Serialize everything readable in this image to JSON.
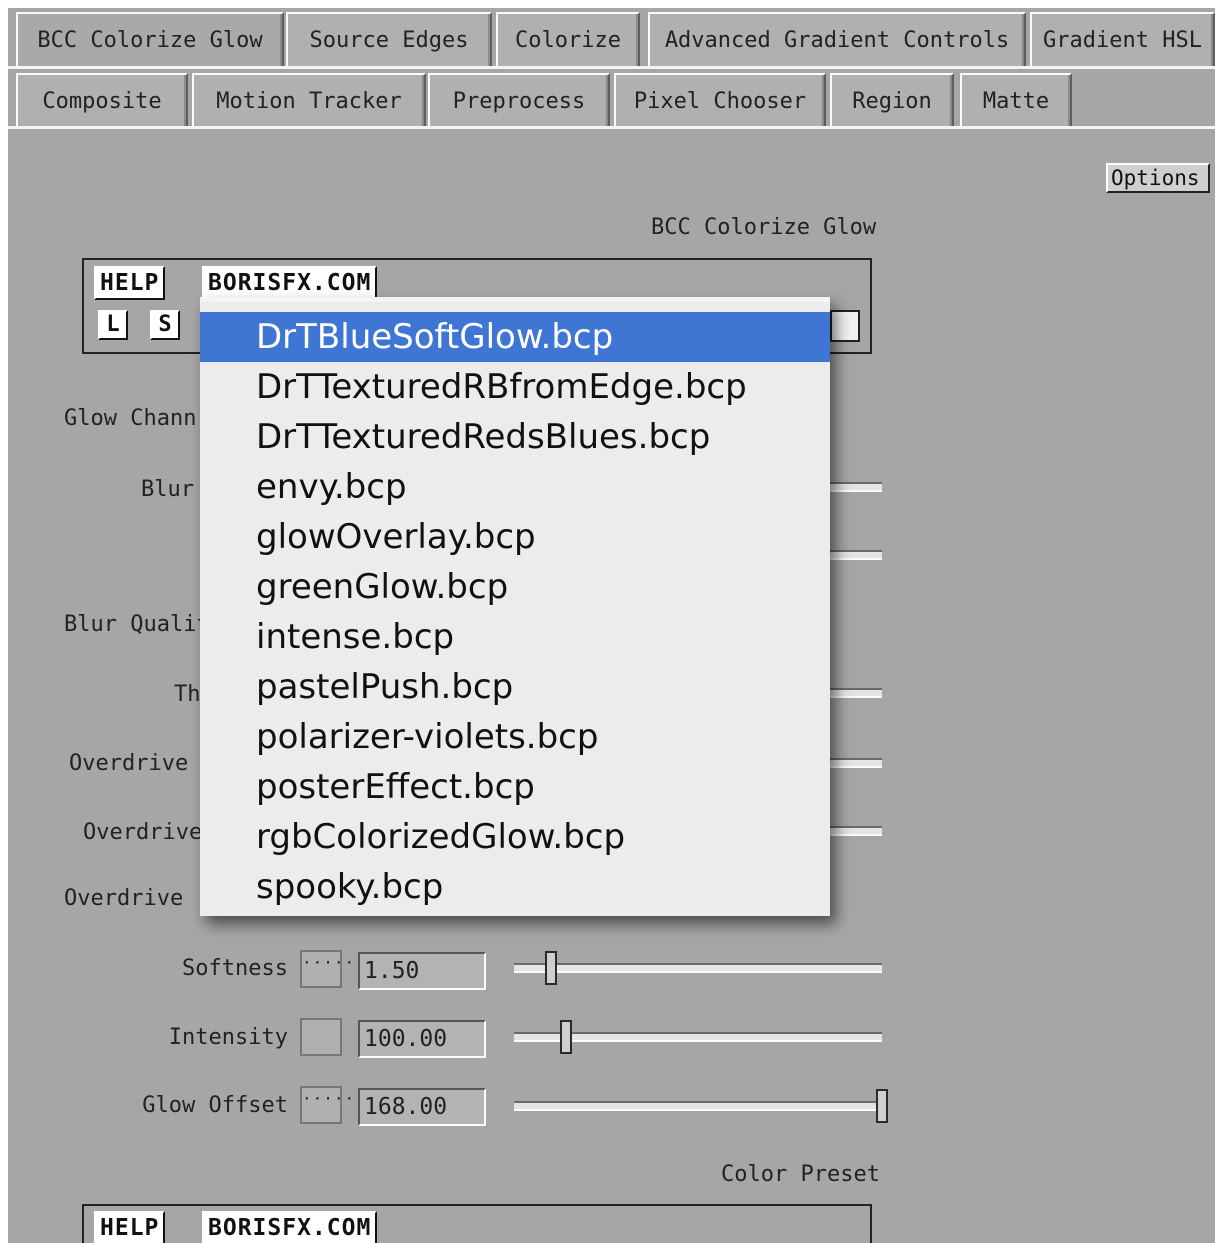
{
  "tabs_row1": [
    "BCC Colorize Glow",
    "Source Edges",
    "Colorize",
    "Advanced Gradient Controls",
    "Gradient HSL"
  ],
  "tabs_row2": [
    "Composite",
    "Motion Tracker",
    "Preprocess",
    "Pixel Chooser",
    "Region",
    "Matte"
  ],
  "options_label": "Options",
  "section_title": "BCC Colorize Glow",
  "help_label": "HELP",
  "site_label": "BORISFX.COM",
  "load_label": "L",
  "save_label": "S",
  "labels": {
    "glow_channel": "Glow Chann",
    "blur": "Blur",
    "blur_quality": "Blur Quality",
    "threshold": "Th",
    "overdrive1": "Overdrive",
    "overdrive2": "Overdrive",
    "overdrive3": "Overdrive"
  },
  "params": [
    {
      "label": "Softness",
      "value": "1.50",
      "chip": "·····",
      "level": 0.1
    },
    {
      "label": "Intensity",
      "value": "100.00",
      "chip": "",
      "level": 0.14
    },
    {
      "label": "Glow Offset",
      "value": "168.00",
      "chip": "·····",
      "level": 1.0
    }
  ],
  "color_preset_title": "Color Preset",
  "dropdown": {
    "items": [
      "DrTBlueSoftGlow.bcp",
      "DrTTexturedRBfromEdge.bcp",
      "DrTTexturedRedsBlues.bcp",
      "envy.bcp",
      "glowOverlay.bcp",
      "greenGlow.bcp",
      "intense.bcp",
      "pastelPush.bcp",
      "polarizer-violets.bcp",
      "posterEffect.bcp",
      "rgbColorizedGlow.bcp",
      "spooky.bcp"
    ],
    "selected_index": 0
  },
  "colors": {
    "panel": "#a6a6a6",
    "selection": "#3f76d4"
  }
}
